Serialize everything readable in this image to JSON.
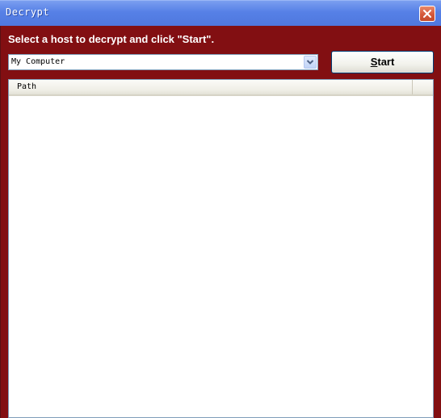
{
  "window": {
    "title": "Decrypt"
  },
  "instruction": "Select a host to decrypt and click \"Start\".",
  "host_select": {
    "selected": "My Computer"
  },
  "start_button": {
    "label_first": "S",
    "label_rest": "tart"
  },
  "results_list": {
    "columns": [
      "Path"
    ],
    "rows": []
  },
  "colors": {
    "client_background": "#820f12",
    "titlebar": "#5680e6"
  },
  "icons": {
    "close": "close-icon",
    "dropdown": "chevron-down-icon"
  }
}
